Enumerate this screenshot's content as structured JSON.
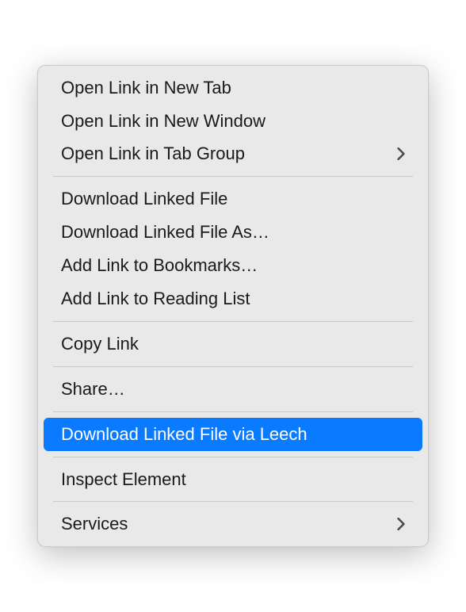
{
  "menu": {
    "groups": [
      {
        "items": [
          {
            "label": "Open Link in New Tab",
            "submenu": false,
            "highlighted": false
          },
          {
            "label": "Open Link in New Window",
            "submenu": false,
            "highlighted": false
          },
          {
            "label": "Open Link in Tab Group",
            "submenu": true,
            "highlighted": false
          }
        ]
      },
      {
        "items": [
          {
            "label": "Download Linked File",
            "submenu": false,
            "highlighted": false
          },
          {
            "label": "Download Linked File As…",
            "submenu": false,
            "highlighted": false
          },
          {
            "label": "Add Link to Bookmarks…",
            "submenu": false,
            "highlighted": false
          },
          {
            "label": "Add Link to Reading List",
            "submenu": false,
            "highlighted": false
          }
        ]
      },
      {
        "items": [
          {
            "label": "Copy Link",
            "submenu": false,
            "highlighted": false
          }
        ]
      },
      {
        "items": [
          {
            "label": "Share…",
            "submenu": false,
            "highlighted": false
          }
        ]
      },
      {
        "items": [
          {
            "label": "Download Linked File via Leech",
            "submenu": false,
            "highlighted": true
          }
        ]
      },
      {
        "items": [
          {
            "label": "Inspect Element",
            "submenu": false,
            "highlighted": false
          }
        ]
      },
      {
        "items": [
          {
            "label": "Services",
            "submenu": true,
            "highlighted": false
          }
        ]
      }
    ]
  }
}
